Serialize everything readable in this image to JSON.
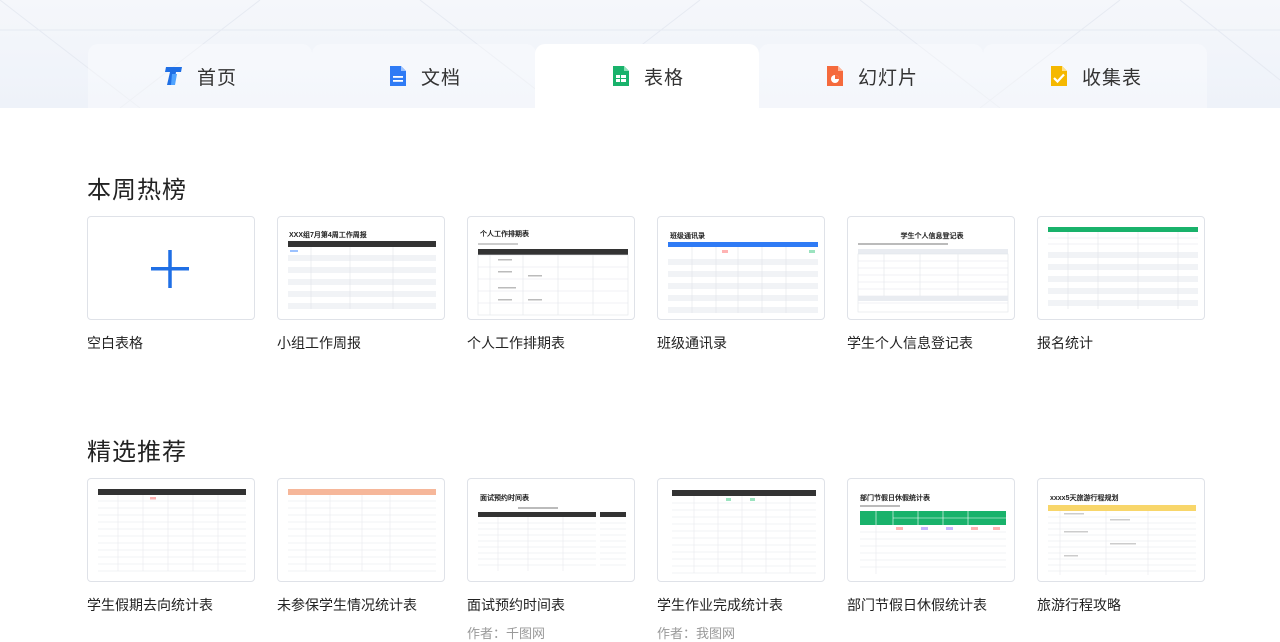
{
  "tabs": [
    {
      "label": "首页",
      "icon": "home-logo-icon",
      "active": false
    },
    {
      "label": "文档",
      "icon": "doc-icon",
      "active": false
    },
    {
      "label": "表格",
      "icon": "sheet-icon",
      "active": true
    },
    {
      "label": "幻灯片",
      "icon": "slides-icon",
      "active": false
    },
    {
      "label": "收集表",
      "icon": "form-icon",
      "active": false
    }
  ],
  "sections": {
    "hot": {
      "title": "本周热榜",
      "cards": [
        {
          "label": "空白表格"
        },
        {
          "label": "小组工作周报",
          "thumb_title": "XXX组7月第4周工作周报"
        },
        {
          "label": "个人工作排期表",
          "thumb_title": "个人工作排期表"
        },
        {
          "label": "班级通讯录",
          "thumb_title": "班级通讯录"
        },
        {
          "label": "学生个人信息登记表",
          "thumb_title": "学生个人信息登记表"
        },
        {
          "label": "报名统计"
        }
      ]
    },
    "featured": {
      "title": "精选推荐",
      "cards": [
        {
          "label": "学生假期去向统计表",
          "author": ""
        },
        {
          "label": "未参保学生情况统计表",
          "author": ""
        },
        {
          "label": "面试预约时间表",
          "thumb_title": "面试预约时间表",
          "author": "作者：千图网"
        },
        {
          "label": "学生作业完成统计表",
          "author": "作者：我图网"
        },
        {
          "label": "部门节假日休假统计表",
          "thumb_title": "部门节假日休假统计表",
          "author": ""
        },
        {
          "label": "旅游行程攻略",
          "thumb_title": "xxxx5天旅游行程规划",
          "author": ""
        }
      ]
    }
  },
  "colors": {
    "accent": "#1f6fe5",
    "sheet_green": "#19b26b",
    "doc_blue": "#2f7bf5",
    "slides_orange": "#f56a3c",
    "form_yellow": "#f5b800"
  }
}
